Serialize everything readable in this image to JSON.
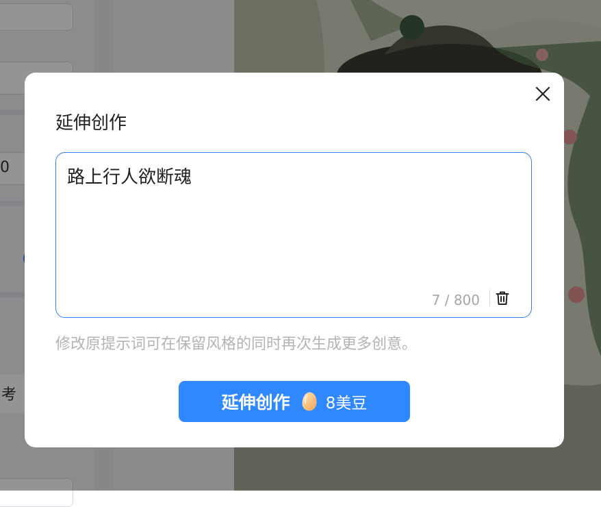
{
  "background": {
    "left_value": "0",
    "left_label_fragment": "考"
  },
  "modal": {
    "title": "延伸创作",
    "prompt_text": "路上行人欲断魂",
    "char_count": "7 / 800",
    "hint": "修改原提示词可在保留风格的同时再次生成更多创意。",
    "action_button": {
      "label": "延伸创作",
      "cost": "8美豆",
      "cost_icon": "bean-icon"
    }
  }
}
